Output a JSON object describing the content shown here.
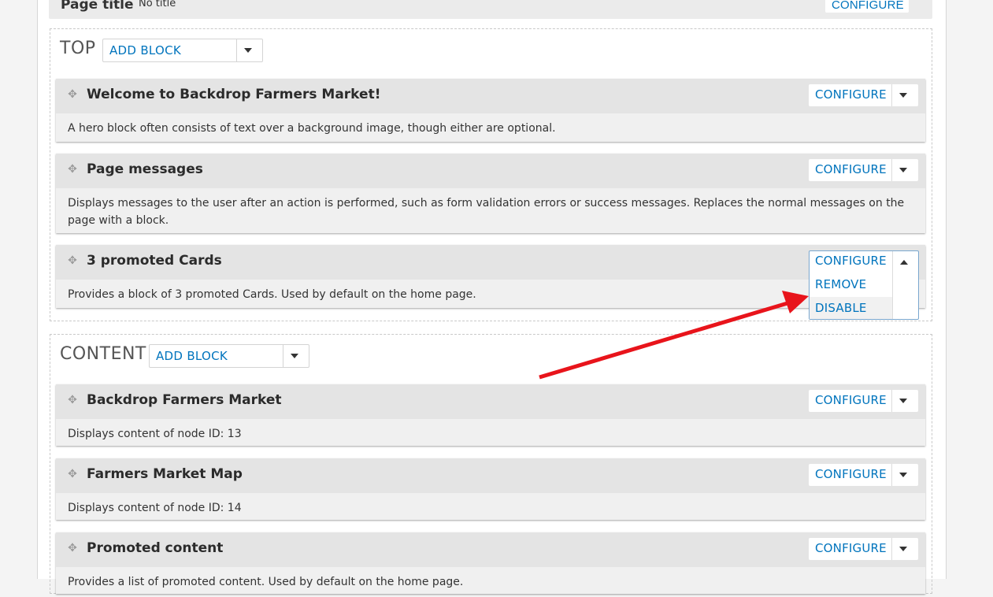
{
  "page_title_row": {
    "label": "Page title",
    "value": "No title",
    "configure_label": "CONFIGURE"
  },
  "regions": {
    "top": {
      "label": "TOP",
      "add_block_label": "ADD BLOCK",
      "blocks": [
        {
          "title": "Welcome to Backdrop Farmers Market!",
          "description": "A hero block often consists of text over a background image, though either are optional.",
          "configure_label": "CONFIGURE"
        },
        {
          "title": "Page messages",
          "description": "Displays messages to the user after an action is performed, such as form validation errors or success messages. Replaces the normal messages on the page with a block.",
          "configure_label": "CONFIGURE"
        },
        {
          "title": "3 promoted Cards",
          "description": "Provides a block of 3 promoted Cards. Used by default on the home page.",
          "configure_label": "CONFIGURE",
          "menu_items": [
            "REMOVE",
            "DISABLE"
          ]
        }
      ]
    },
    "content": {
      "label": "CONTENT",
      "add_block_label": "ADD BLOCK",
      "blocks": [
        {
          "title": "Backdrop Farmers Market",
          "description": "Displays content of node ID: 13",
          "configure_label": "CONFIGURE"
        },
        {
          "title": "Farmers Market Map",
          "description": "Displays content of node ID: 14",
          "configure_label": "CONFIGURE"
        },
        {
          "title": "Promoted content",
          "description": "Provides a list of promoted content. Used by default on the home page.",
          "configure_label": "CONFIGURE"
        }
      ]
    }
  },
  "icons": {
    "drag_handle": "drag-handle-icon",
    "dropdown": "chevron-down-icon",
    "dropdown_open": "chevron-up-icon",
    "annotation": "arrow-icon"
  },
  "colors": {
    "link": "#0074bd",
    "annotation_arrow": "#e8141b"
  }
}
